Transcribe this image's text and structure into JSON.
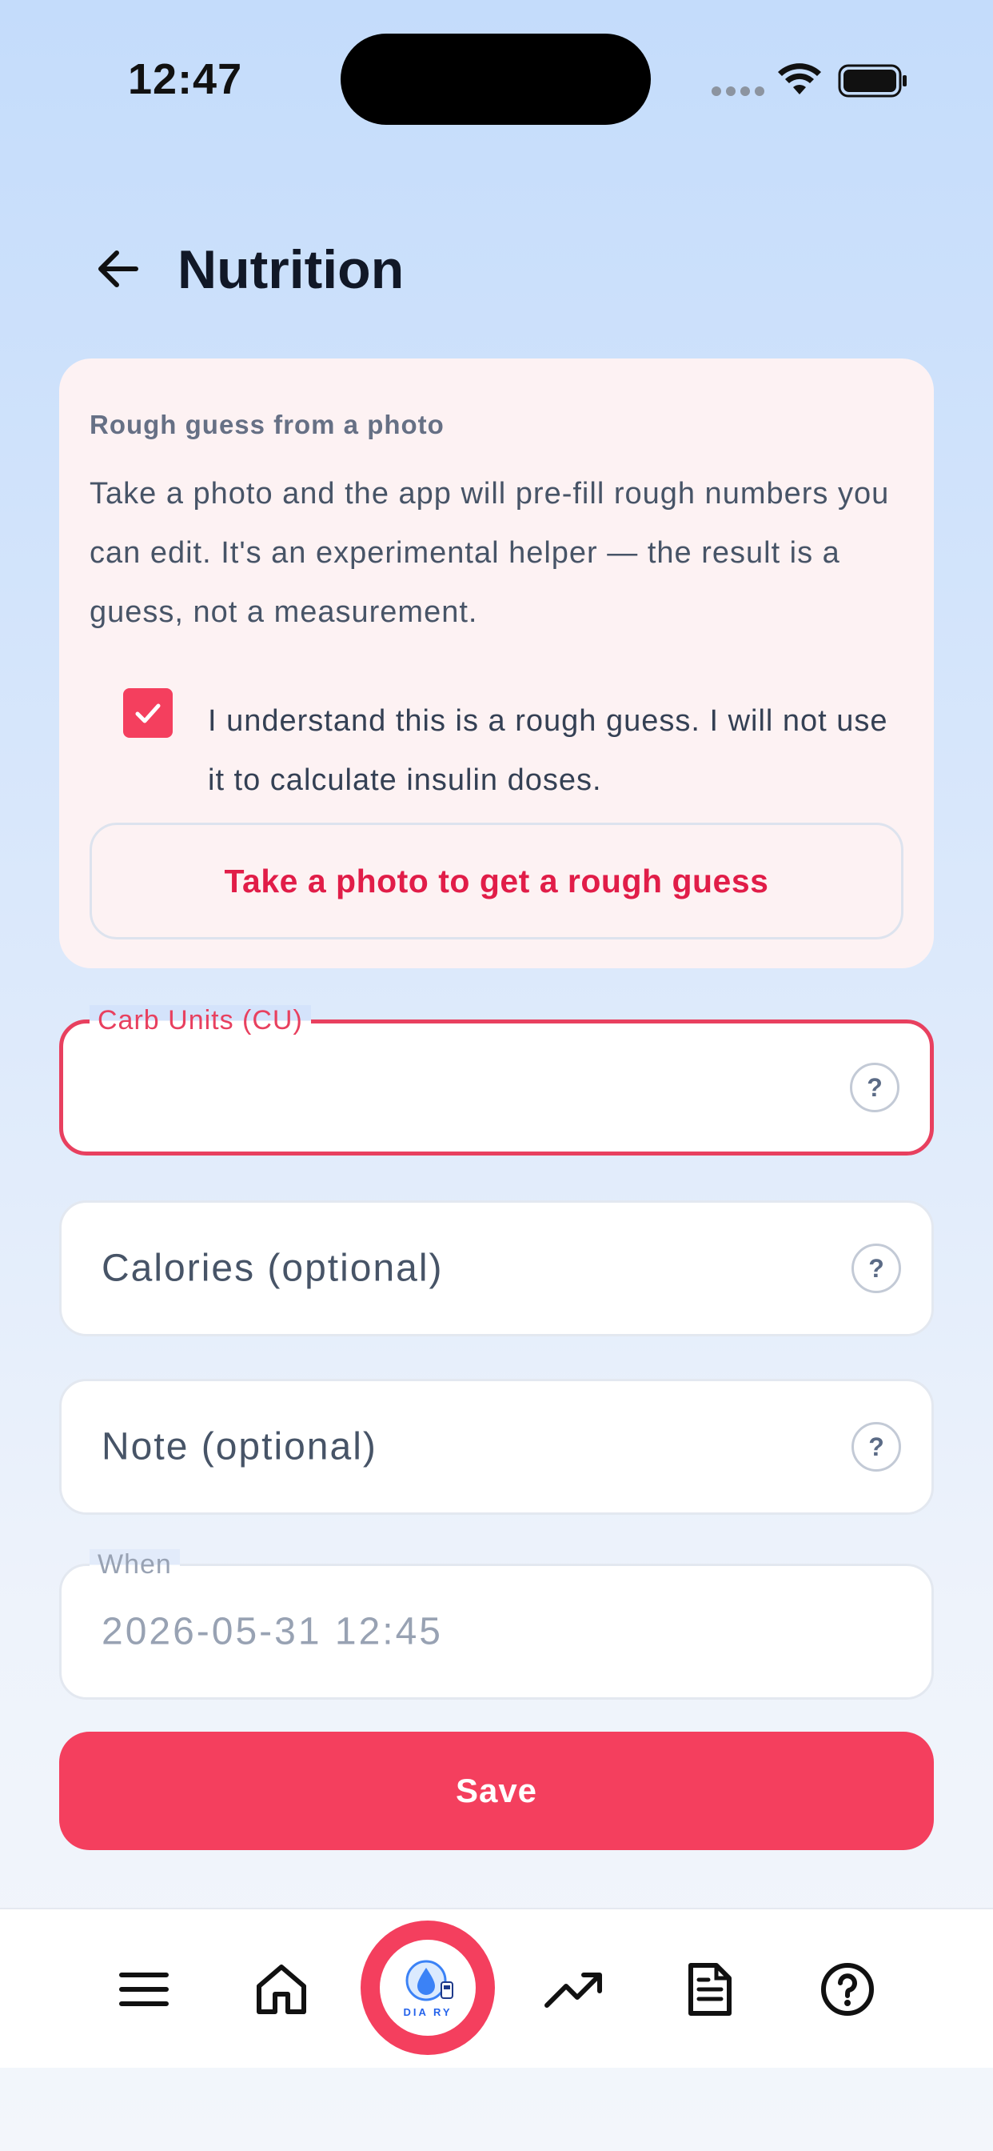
{
  "status_bar": {
    "time": "12:47"
  },
  "header": {
    "title": "Nutrition"
  },
  "photo_card": {
    "label": "Rough guess from a photo",
    "description": "Take a photo and the app will pre-fill rough numbers you can edit. It's an experimental helper — the result is a guess, not a measurement.",
    "acknowledgement": "I understand this is a rough guess. I will not use it to calculate insulin doses.",
    "acknowledged": true,
    "button_label": "Take a photo to get a rough guess"
  },
  "form": {
    "carb_units": {
      "label": "Carb Units (CU)",
      "value": ""
    },
    "calories": {
      "placeholder": "Calories (optional)"
    },
    "note": {
      "placeholder": "Note (optional)"
    },
    "when": {
      "label": "When",
      "value": "2026-05-31  12:45"
    },
    "help_glyph": "?"
  },
  "save_label": "Save",
  "bottom_nav": {
    "items": [
      "menu-icon",
      "home-icon",
      "diary-logo",
      "trend-icon",
      "document-icon",
      "help-icon"
    ],
    "logo_text": "DIA RY"
  },
  "colors": {
    "accent": "#f43f5e",
    "accent_text": "#e11d48"
  }
}
